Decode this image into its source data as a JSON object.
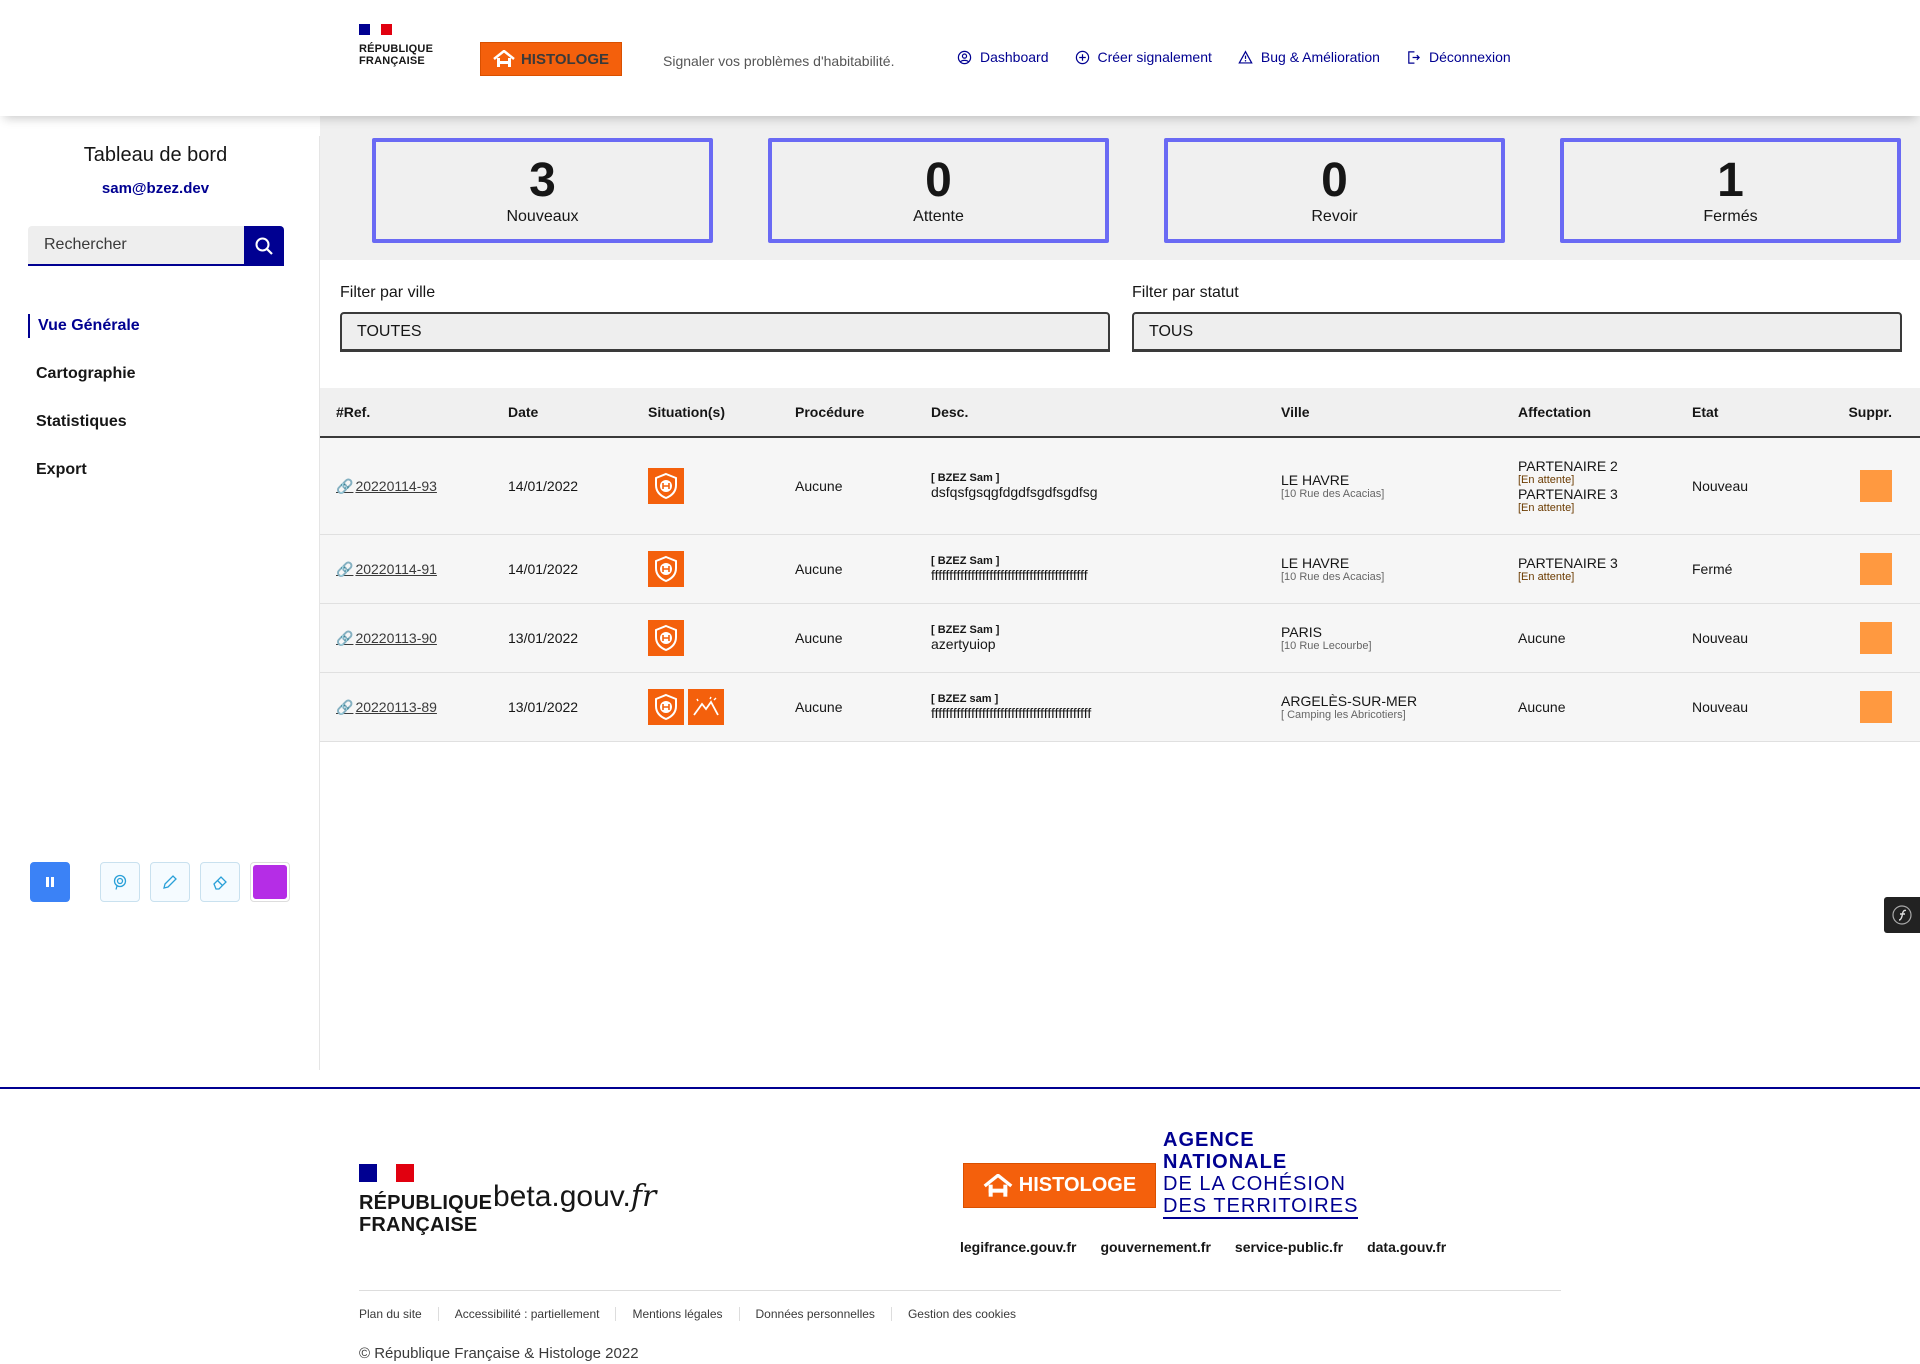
{
  "header": {
    "rf_label": "RÉPUBLIQUE\nFRANÇAISE",
    "brand": "HISTOLOGE",
    "tagline": "Signaler vos problèmes d'habitabilité.",
    "nav": [
      {
        "label": "Dashboard",
        "icon": "user-circle-icon"
      },
      {
        "label": "Créer signalement",
        "icon": "add-circle-icon"
      },
      {
        "label": "Bug & Amélioration",
        "icon": "warning-icon"
      },
      {
        "label": "Déconnexion",
        "icon": "logout-icon"
      }
    ]
  },
  "sidebar": {
    "title": "Tableau de bord",
    "email": "sam@bzez.dev",
    "search_placeholder": "Rechercher",
    "nav": [
      "Vue Générale",
      "Cartographie",
      "Statistiques",
      "Export"
    ],
    "active_index": 0,
    "tools": [
      "pause-icon",
      "lasso-icon",
      "pencil-icon",
      "eraser-icon",
      "color-swatch"
    ]
  },
  "stats": [
    {
      "value": "3",
      "label": "Nouveaux"
    },
    {
      "value": "0",
      "label": "Attente"
    },
    {
      "value": "0",
      "label": "Revoir"
    },
    {
      "value": "1",
      "label": "Fermés"
    }
  ],
  "filters": {
    "city": {
      "label": "Filter par ville",
      "value": "TOUTES"
    },
    "status": {
      "label": "Filter par statut",
      "value": "TOUS"
    }
  },
  "table": {
    "headers": [
      "#Ref.",
      "Date",
      "Situation(s)",
      "Procédure",
      "Desc.",
      "Ville",
      "Affectation",
      "Etat",
      "Suppr."
    ],
    "rows": [
      {
        "ref": "20220114-93",
        "date": "14/01/2022",
        "situations": [
          "shield-house-icon"
        ],
        "procedure": "Aucune",
        "desc_author": "[ BZEZ Sam ]",
        "desc": "dsfqsfgsqgfdgdfsgdfsgdfsg",
        "city": "LE HAVRE",
        "address": "[10 Rue des Acacias]",
        "affectations": [
          {
            "name": "PARTENAIRE 2",
            "status": "[En attente]"
          },
          {
            "name": "PARTENAIRE 3",
            "status": "[En attente]"
          }
        ],
        "etat": "Nouveau"
      },
      {
        "ref": "20220114-91",
        "date": "14/01/2022",
        "situations": [
          "shield-house-icon"
        ],
        "procedure": "Aucune",
        "desc_author": "[ BZEZ Sam ]",
        "desc": "fffffffffffffffffffffffffffffffffffffffffff",
        "city": "LE HAVRE",
        "address": "[10 Rue des Acacias]",
        "affectations": [
          {
            "name": "PARTENAIRE 3",
            "status": "[En attente]"
          }
        ],
        "etat": "Fermé"
      },
      {
        "ref": "20220113-90",
        "date": "13/01/2022",
        "situations": [
          "shield-house-icon"
        ],
        "procedure": "Aucune",
        "desc_author": "[ BZEZ Sam ]",
        "desc": "azertyuiop",
        "city": "PARIS",
        "address": "[10 Rue Lecourbe]",
        "affectations_text": "Aucune",
        "etat": "Nouveau"
      },
      {
        "ref": "20220113-89",
        "date": "13/01/2022",
        "situations": [
          "shield-house-icon",
          "mountain-icon"
        ],
        "procedure": "Aucune",
        "desc_author": "[ BZEZ sam ]",
        "desc": "ffffffffffffffffffffffffffffffffffffffffffff",
        "city": "ARGELÈS-SUR-MER",
        "address": "[ Camping les Abricotiers]",
        "affectations_text": "Aucune",
        "etat": "Nouveau"
      }
    ]
  },
  "footer": {
    "rf_label": "RÉPUBLIQUE\nFRANÇAISE",
    "beta_main": "beta.gouv.",
    "beta_tld": "fr",
    "brand": "HISTOLOGE",
    "anct": [
      "AGENCE",
      "NATIONALE",
      "DE LA COHÉSION",
      "DES TERRITOIRES"
    ],
    "links": [
      "legifrance.gouv.fr",
      "gouvernement.fr",
      "service-public.fr",
      "data.gouv.fr"
    ],
    "bottom_links": [
      "Plan du site",
      "Accessibilité : partiellement",
      "Mentions légales",
      "Données personnelles",
      "Gestion des cookies"
    ],
    "copyright": "© République Française & Histologe 2022"
  },
  "colors": {
    "brand": "#000091",
    "histologe": "#f4600c",
    "stat_border": "#6a6af4",
    "delete": "#ff9940"
  }
}
